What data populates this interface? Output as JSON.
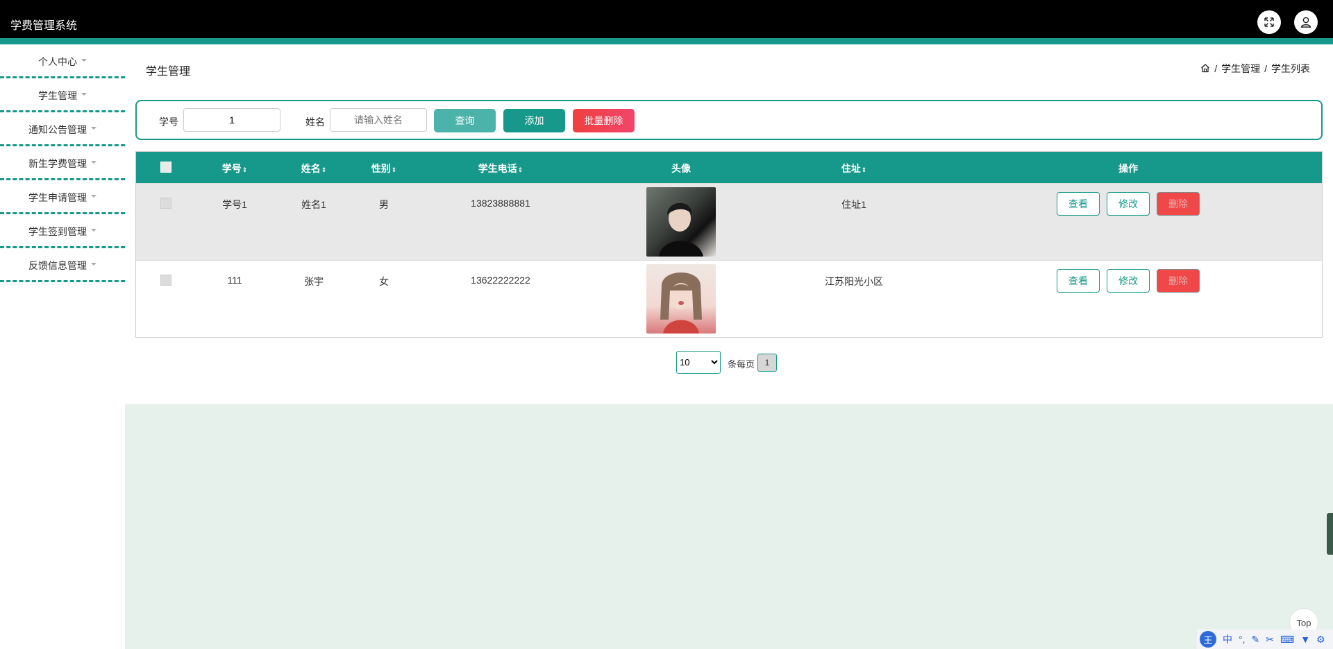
{
  "app": {
    "title": "学费管理系统"
  },
  "sidebar": {
    "items": [
      {
        "label": "个人中心"
      },
      {
        "label": "学生管理"
      },
      {
        "label": "通知公告管理"
      },
      {
        "label": "新生学费管理"
      },
      {
        "label": "学生申请管理"
      },
      {
        "label": "学生签到管理"
      },
      {
        "label": "反馈信息管理"
      }
    ]
  },
  "page": {
    "title": "学生管理"
  },
  "breadcrumb": {
    "items": [
      "学生管理",
      "学生列表"
    ],
    "separator": "/"
  },
  "search": {
    "student_no_label": "学号",
    "student_no_value": "1",
    "name_label": "姓名",
    "name_placeholder": "请输入姓名",
    "query_btn": "查询",
    "add_btn": "添加",
    "batch_delete_btn": "批量删除"
  },
  "table": {
    "headers": {
      "student_no": "学号",
      "name": "姓名",
      "gender": "性别",
      "phone": "学生电话",
      "avatar": "头像",
      "address": "住址",
      "actions": "操作"
    },
    "sort_glyph": "⇕",
    "rows": [
      {
        "student_no": "学号1",
        "name": "姓名1",
        "gender": "男",
        "phone": "13823888881",
        "address": "住址1"
      },
      {
        "student_no": "111",
        "name": "张宇",
        "gender": "女",
        "phone": "13622222222",
        "address": "江苏阳光小区"
      }
    ],
    "actions": {
      "view": "查看",
      "edit": "修改",
      "delete": "删除"
    }
  },
  "pagination": {
    "page_size": "10",
    "page_size_options": [
      "10"
    ],
    "per_page_label": "条每页",
    "current_page": "1"
  },
  "widgets": {
    "top_label": "Top",
    "ime_label": "中",
    "ime_logo": "王"
  },
  "colors": {
    "primary": "#16988a",
    "danger": "#f04848",
    "topbar": "#000000"
  }
}
